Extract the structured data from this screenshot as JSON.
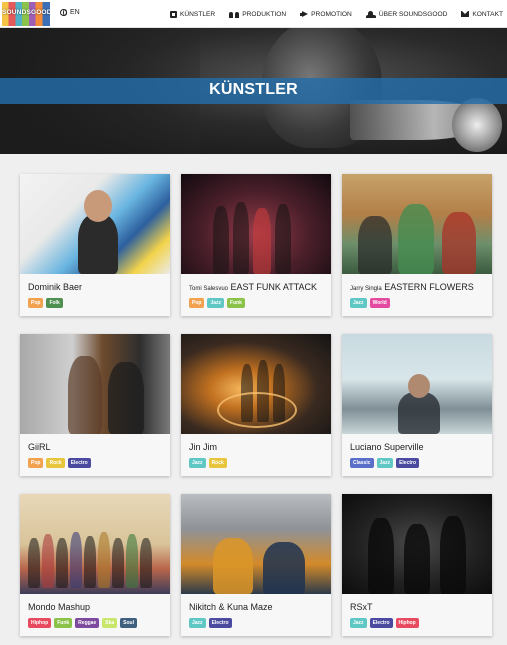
{
  "logo": {
    "text": "SOUNDSGOOD"
  },
  "lang": {
    "label": "EN",
    "icon": "globe-icon"
  },
  "nav": [
    {
      "label": "KÜNSTLER",
      "icon": "book-icon"
    },
    {
      "label": "PRODUKTION",
      "icon": "people-icon"
    },
    {
      "label": "PROMOTION",
      "icon": "megaphone-icon"
    },
    {
      "label": "ÜBER SOUNDSGOOD",
      "icon": "users-icon"
    },
    {
      "label": "KONTAKT",
      "icon": "envelope-icon"
    }
  ],
  "hero": {
    "title": "KÜNSTLER"
  },
  "colors": {
    "Pop": "#f2a24e",
    "Folk": "#4f8f4f",
    "Jazz": "#5fc7c4",
    "Funk": "#8bc34a",
    "World": "#e44aa0",
    "Rock": "#e7c53c",
    "Electro": "#4a4aa0",
    "Classic": "#5b6fc9",
    "Hiphop": "#e84a5f",
    "Reggae": "#7e4aa0",
    "Ska": "#c8e66a",
    "Soul": "#3f5f7f"
  },
  "artists": [
    {
      "prefix": "",
      "name": "Dominik Baer",
      "tags": [
        "Pop",
        "Folk"
      ]
    },
    {
      "prefix": "Tomi Salesvuo",
      "name": "EAST FUNK ATTACK",
      "tags": [
        "Pop",
        "Jazz",
        "Funk"
      ]
    },
    {
      "prefix": "Jarry Singla",
      "name": "EASTERN FLOWERS",
      "tags": [
        "Jazz",
        "World"
      ]
    },
    {
      "prefix": "",
      "name": "GiiRL",
      "tags": [
        "Pop",
        "Rock",
        "Electro"
      ]
    },
    {
      "prefix": "",
      "name": "Jin Jim",
      "tags": [
        "Jazz",
        "Rock"
      ]
    },
    {
      "prefix": "",
      "name": "Luciano Superville",
      "tags": [
        "Classic",
        "Jazz",
        "Electro"
      ]
    },
    {
      "prefix": "",
      "name": "Mondo Mashup",
      "tags": [
        "Hiphop",
        "Funk",
        "Reggae",
        "Ska",
        "Soul"
      ]
    },
    {
      "prefix": "",
      "name": "Nikitch & Kuna Maze",
      "tags": [
        "Jazz",
        "Electro"
      ]
    },
    {
      "prefix": "",
      "name": "RSxT",
      "tags": [
        "Jazz",
        "Electro",
        "Hiphop"
      ]
    }
  ]
}
